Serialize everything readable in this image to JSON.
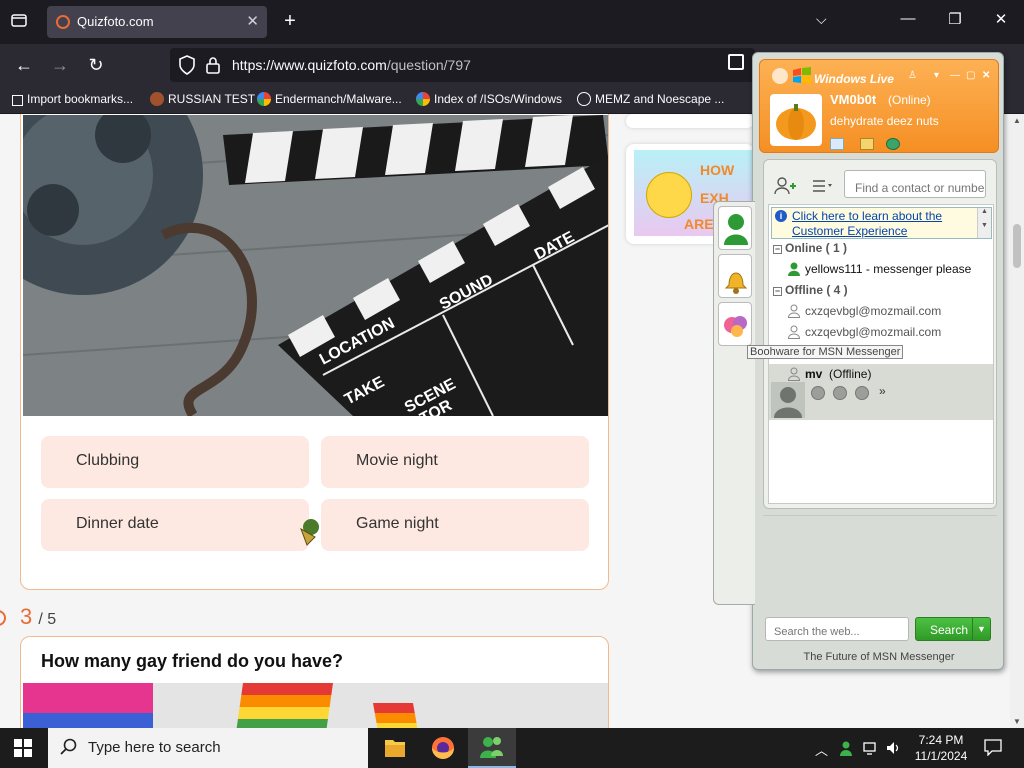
{
  "browser": {
    "tab_title": "Quizfoto.com",
    "url_host": "https://www.quizfoto.com",
    "url_path": "/question/797",
    "bookmarks": [
      {
        "label": "Import bookmarks..."
      },
      {
        "label": "RUSSIAN TEST"
      },
      {
        "label": "Endermanch/Malware..."
      },
      {
        "label": "Index of /ISOs/Windows"
      },
      {
        "label": "MEMZ and Noescape ..."
      }
    ]
  },
  "page": {
    "options": [
      "Clubbing",
      "Movie night",
      "Dinner date",
      "Game night"
    ],
    "progress_current": "3",
    "progress_total": "/ 5",
    "next_question": "How many gay friend do you have?",
    "clapper_text": [
      "LOCATION",
      "SOUND",
      "DATE",
      "TAKE",
      "SCENE",
      "ACTOR"
    ],
    "side_card_text": [
      "HOW",
      "EXH",
      "ARE"
    ]
  },
  "messenger": {
    "title": "Windows Live",
    "username": "VM0b0t",
    "status": "(Online)",
    "personal_message": "dehydrate deez nuts",
    "find_placeholder": "Find a contact or number",
    "info_link": "Click here to learn about the Customer Experience",
    "online_group": "Online ( 1 )",
    "offline_group": "Offline ( 4 )",
    "online_contacts": [
      "yellows111 - messenger please"
    ],
    "offline_contacts": [
      "cxzqevbgl@mozmail.com",
      "cxzqevbgl@mozmail.com"
    ],
    "tooltip": "Boohware for MSN Messenger",
    "selected_contact_name": "mv",
    "selected_contact_status": "(Offline)",
    "more_glyph": "»",
    "search_placeholder": "Search the web...",
    "search_button": "Search",
    "footer": "The Future of MSN Messenger"
  },
  "taskbar": {
    "search_placeholder": "Type here to search",
    "time": "7:24 PM",
    "date": "11/1/2024"
  },
  "colors": {
    "accent_orange": "#e96b38",
    "option_bg": "#fde9e1",
    "msn_header": "#f58f24",
    "search_green": "#2f9a26"
  }
}
